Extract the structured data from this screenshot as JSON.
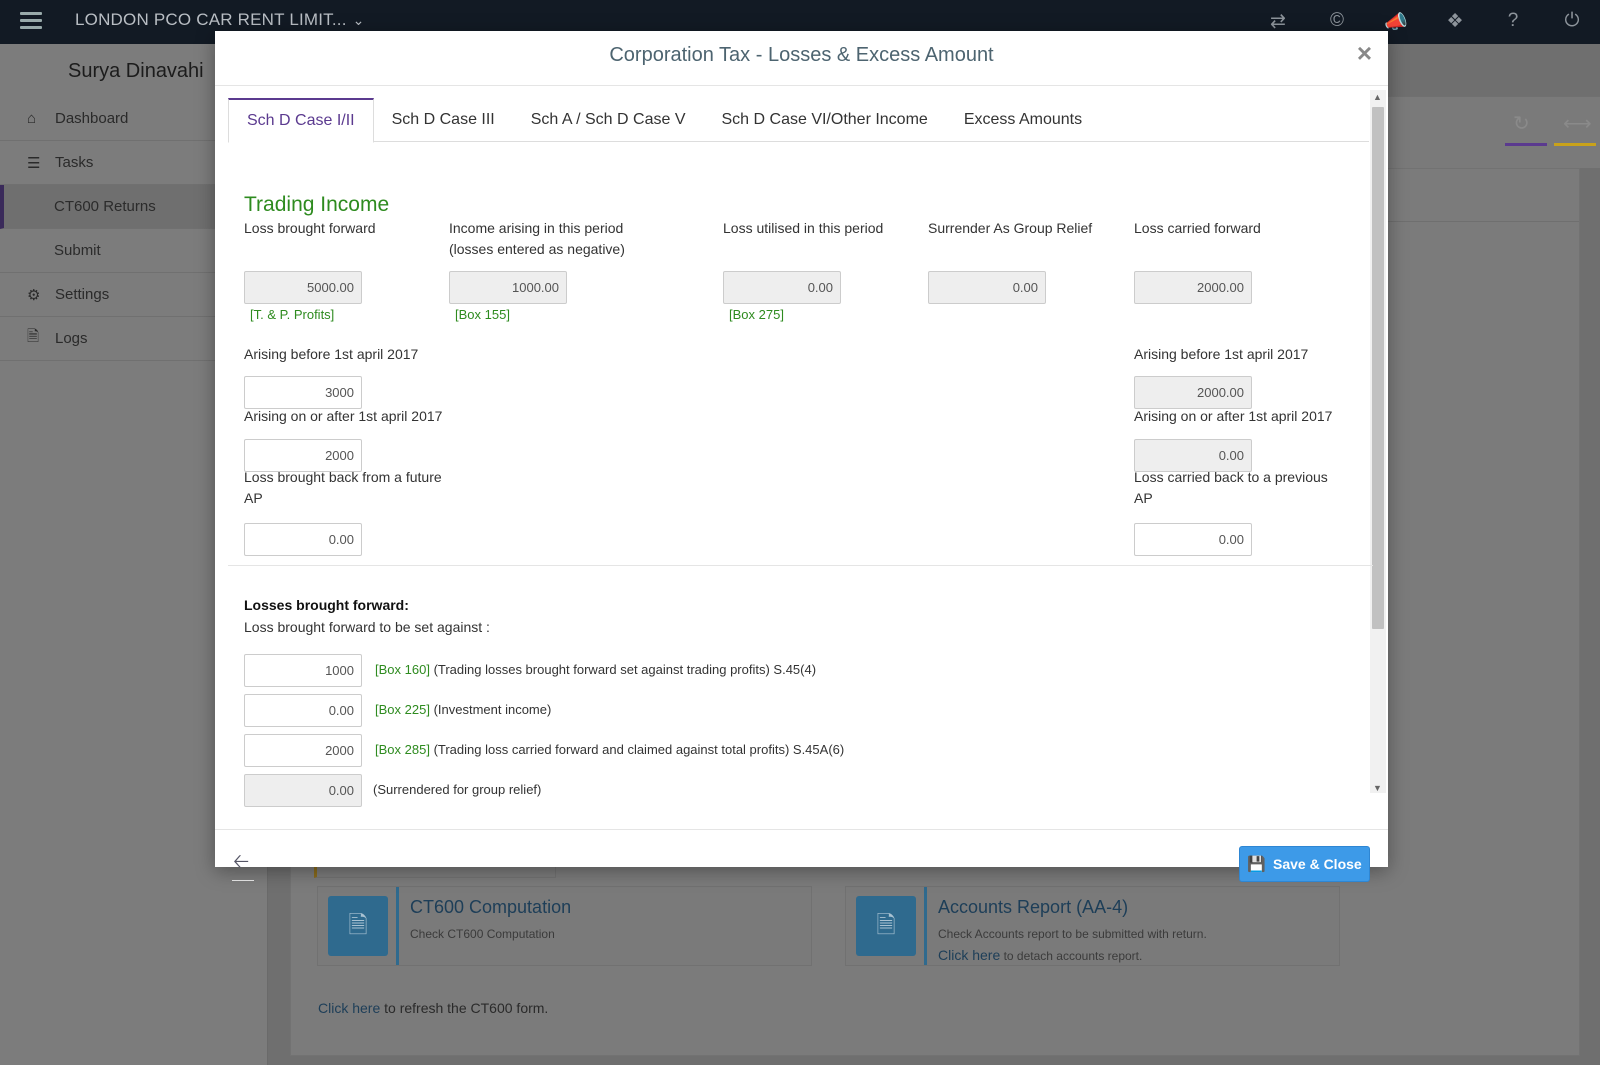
{
  "topbar": {
    "company": "LONDON PCO CAR RENT LIMIT...",
    "icons": [
      "swap-icon",
      "copyright-icon",
      "megaphone-icon",
      "tag-icon",
      "help-icon",
      "power-icon"
    ]
  },
  "sidebar": {
    "user": "Surya Dinavahi",
    "items": [
      {
        "label": "Dashboard",
        "icon": "home-icon"
      },
      {
        "label": "Tasks",
        "icon": "tasks-icon"
      },
      {
        "label": "CT600 Returns"
      },
      {
        "label": "Submit"
      },
      {
        "label": "Settings",
        "icon": "gear-icon"
      },
      {
        "label": "Logs",
        "icon": "file-icon"
      }
    ]
  },
  "background": {
    "cards": [
      {
        "title": "CT600 Computation",
        "subtitle": "Check CT600 Computation"
      },
      {
        "title": "Accounts Report (AA-4)",
        "subtitle": "Check Accounts report to be submitted with return.",
        "link": "Click here",
        "link_suffix": "to detach accounts report."
      }
    ],
    "refresh_link": "Click here",
    "refresh_text": "to refresh the CT600 form.",
    "accent_colors": [
      "#5b3a8f",
      "#c9a21a"
    ]
  },
  "modal": {
    "title": "Corporation Tax - Losses & Excess Amount",
    "close": "×",
    "tabs": [
      "Sch D Case I/II",
      "Sch D Case III",
      "Sch A / Sch D Case V",
      "Sch D Case VI/Other Income",
      "Excess Amounts"
    ],
    "active_tab": "Sch D Case I/II",
    "section_title": "Trading Income",
    "columns": {
      "loss_bf": {
        "label": "Loss brought forward",
        "value": "5000.00",
        "box": "[T. & P. Profits]"
      },
      "income": {
        "label_line1": "Income arising in this period",
        "label_line2": "(losses entered as negative)",
        "value": "1000.00",
        "box": "[Box 155]"
      },
      "utilised": {
        "label": "Loss utilised in this period",
        "value": "0.00",
        "box": "[Box 275]"
      },
      "group_relief": {
        "label": "Surrender As Group Relief",
        "value": "0.00"
      },
      "loss_cf": {
        "label": "Loss carried forward",
        "value": "2000.00"
      }
    },
    "left_sub": {
      "before_label": "Arising before 1st april 2017",
      "before_value": "3000",
      "after_label": "Arising on or after 1st april 2017",
      "after_value": "2000",
      "back_label_line1": "Loss brought back from a future",
      "back_label_line2": "AP",
      "back_value": "0.00"
    },
    "right_sub": {
      "before_label": "Arising before 1st april 2017",
      "before_value": "2000.00",
      "after_label": "Arising on or after 1st april 2017",
      "after_value": "0.00",
      "back_label_line1": "Loss carried back to a previous",
      "back_label_line2": "AP",
      "back_value": "0.00"
    },
    "losses_bf": {
      "heading": "Losses brought forward:",
      "subheading": "Loss brought forward to be set against :",
      "rows": [
        {
          "value": "1000",
          "box": "[Box 160]",
          "text": "(Trading losses brought forward set against trading profits) S.45(4)"
        },
        {
          "value": "0.00",
          "box": "[Box 225]",
          "text": "(Investment income)"
        },
        {
          "value": "2000",
          "box": "[Box 285]",
          "text": "(Trading loss carried forward and claimed against total profits) S.45A(6)"
        },
        {
          "value": "0.00",
          "box": "",
          "text": "(Surrendered for group relief)"
        }
      ]
    },
    "footer": {
      "save_label": "Save & Close",
      "back_icon": "arrow-left-icon",
      "save_icon": "floppy-disk-icon",
      "save_color": "#3d9ae8"
    }
  }
}
